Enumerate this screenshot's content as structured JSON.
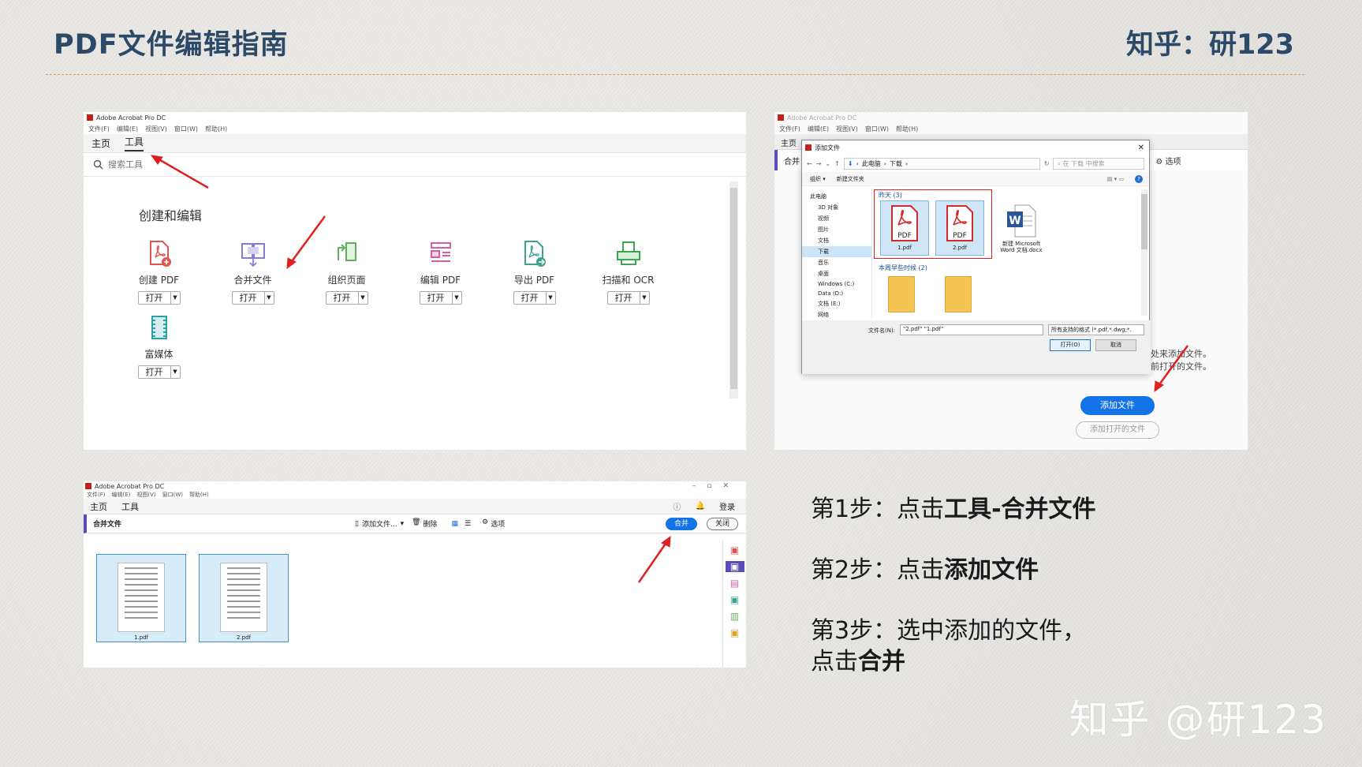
{
  "header": {
    "title": "PDF文件编辑指南",
    "author": "知乎：研123"
  },
  "shot1": {
    "app_title": "Adobe Acrobat Pro DC",
    "menu": [
      "文件(F)",
      "编辑(E)",
      "视图(V)",
      "窗口(W)",
      "帮助(H)"
    ],
    "tabs": [
      "主页",
      "工具"
    ],
    "search_placeholder": "搜索工具",
    "section": "创建和编辑",
    "tools": [
      {
        "label": "创建 PDF",
        "icon": "create-pdf-icon",
        "color": "#e2554f"
      },
      {
        "label": "合并文件",
        "icon": "combine-files-icon",
        "color": "#8c7ad6"
      },
      {
        "label": "组织页面",
        "icon": "organize-pages-icon",
        "color": "#5fb05a"
      },
      {
        "label": "编辑 PDF",
        "icon": "edit-pdf-icon",
        "color": "#d45fa8"
      },
      {
        "label": "导出 PDF",
        "icon": "export-pdf-icon",
        "color": "#3ca38f"
      },
      {
        "label": "扫描和 OCR",
        "icon": "scan-ocr-icon",
        "color": "#3ea64c"
      },
      {
        "label": "富媒体",
        "icon": "rich-media-icon",
        "color": "#2d9ea8"
      }
    ],
    "open_label": "打开"
  },
  "shot2": {
    "app_title": "Adobe Acrobat Pro DC",
    "menu": [
      "文件(F)",
      "编辑(E)",
      "视图(V)",
      "窗口(W)",
      "帮助(H)"
    ],
    "bg_tab": "主页",
    "bg_combine": "合并",
    "bg_options": "选项",
    "dialog_title": "添加文件",
    "path": [
      "此电脑",
      "下载"
    ],
    "search_placeholder": "在 下载 中搜索",
    "toolbar": [
      "组织 ▾",
      "新建文件夹"
    ],
    "tree": [
      "此电脑",
      "3D 对象",
      "视频",
      "图片",
      "文档",
      "下载",
      "音乐",
      "桌面",
      "Windows (C:)",
      "Data (D:)",
      "文档 (E:)",
      "网络"
    ],
    "group1": "昨天 (3)",
    "group2": "本周早些时候 (2)",
    "files": [
      {
        "name": "1.pdf",
        "type": "PDF"
      },
      {
        "name": "2.pdf",
        "type": "PDF"
      },
      {
        "name": "新建 Microsoft Word 文档.docx",
        "type": "W"
      }
    ],
    "filename_label": "文件名(N):",
    "filename_value": "\"2.pdf\" \"1.pdf\"",
    "filetype_value": "所有支持的格式 (*.pdf,*.dwg;*.",
    "open_btn": "打开(O)",
    "cancel_btn": "取消",
    "hint1": "通过单击下面的按钮或拖到此处来添加文件。",
    "hint2": "您也可以从下面添加当前打开的文件。",
    "add_btn": "添加文件",
    "add_open_btn": "添加打开的文件"
  },
  "shot3": {
    "app_title": "Adobe Acrobat Pro DC",
    "menu": [
      "文件(F)",
      "编辑(E)",
      "视图(V)",
      "窗口(W)",
      "帮助(H)"
    ],
    "tabs": [
      "主页",
      "工具"
    ],
    "login": "登录",
    "bar_title": "合并文件",
    "add_files": "添加文件...",
    "delete": "删除",
    "options": "选项",
    "combine": "合并",
    "close": "关闭",
    "files": [
      "1.pdf",
      "2.pdf"
    ]
  },
  "steps": {
    "s1_prefix": "第1步：点击",
    "s1_bold": "工具-合并文件",
    "s2_prefix": "第2步：点击",
    "s2_bold": "添加文件",
    "s3_line1": "第3步：选中添加的文件，",
    "s3_prefix": "点击",
    "s3_bold": "合并"
  },
  "watermark": "知乎 @研123"
}
